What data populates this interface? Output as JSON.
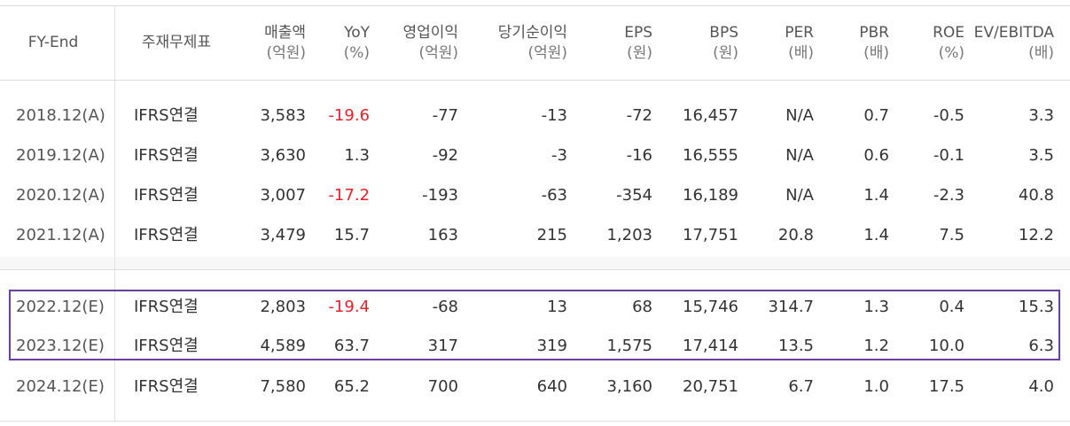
{
  "headers": [
    {
      "label": "FY-End",
      "unit": ""
    },
    {
      "label": "주재무제표",
      "unit": ""
    },
    {
      "label": "매출액",
      "unit": "(억원)"
    },
    {
      "label": "YoY",
      "unit": "(%)"
    },
    {
      "label": "영업이익",
      "unit": "(억원)"
    },
    {
      "label": "당기순이익",
      "unit": "(억원)"
    },
    {
      "label": "EPS",
      "unit": "(원)"
    },
    {
      "label": "BPS",
      "unit": "(원)"
    },
    {
      "label": "PER",
      "unit": "(배)"
    },
    {
      "label": "PBR",
      "unit": "(배)"
    },
    {
      "label": "ROE",
      "unit": "(%)"
    },
    {
      "label": "EV/EBITDA",
      "unit": "(배)"
    }
  ],
  "rows": [
    [
      "2018.12(A)",
      "IFRS연결",
      "3,583",
      "-19.6",
      "-77",
      "-13",
      "-72",
      "16,457",
      "N/A",
      "0.7",
      "-0.5",
      "3.3"
    ],
    [
      "2019.12(A)",
      "IFRS연결",
      "3,630",
      "1.3",
      "-92",
      "-3",
      "-16",
      "16,555",
      "N/A",
      "0.6",
      "-0.1",
      "3.5"
    ],
    [
      "2020.12(A)",
      "IFRS연결",
      "3,007",
      "-17.2",
      "-193",
      "-63",
      "-354",
      "16,189",
      "N/A",
      "1.4",
      "-2.3",
      "40.8"
    ],
    [
      "2021.12(A)",
      "IFRS연결",
      "3,479",
      "15.7",
      "163",
      "215",
      "1,203",
      "17,751",
      "20.8",
      "1.4",
      "7.5",
      "12.2"
    ],
    [
      "2022.12(E)",
      "IFRS연결",
      "2,803",
      "-19.4",
      "-68",
      "13",
      "68",
      "15,746",
      "314.7",
      "1.3",
      "0.4",
      "15.3"
    ],
    [
      "2023.12(E)",
      "IFRS연결",
      "4,589",
      "63.7",
      "317",
      "319",
      "1,575",
      "17,414",
      "13.5",
      "1.2",
      "10.0",
      "6.3"
    ],
    [
      "2024.12(E)",
      "IFRS연결",
      "7,580",
      "65.2",
      "700",
      "640",
      "3,160",
      "20,751",
      "6.7",
      "1.0",
      "17.5",
      "4.0"
    ]
  ],
  "colors": {
    "negative_yoy": "#e8202a",
    "highlight_border": "#6b3fa0"
  }
}
